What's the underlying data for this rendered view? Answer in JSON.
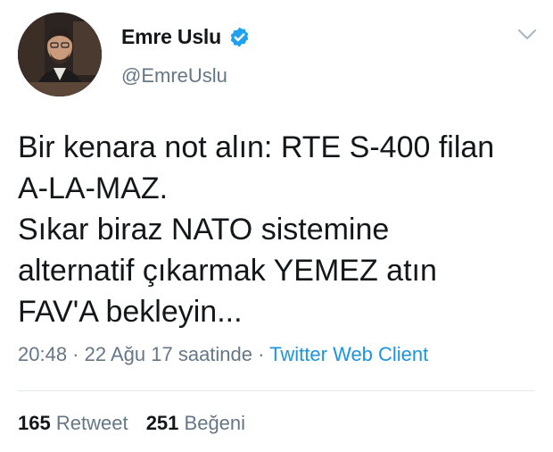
{
  "author": {
    "display_name": "Emre Uslu",
    "handle": "@EmreUslu",
    "verified": true
  },
  "icons": {
    "verified": "verified-badge-icon",
    "menu": "chevron-down-icon"
  },
  "tweet": {
    "lines": [
      "Bir kenara not alın: RTE S-400 filan",
      "A-LA-MAZ.",
      "Sıkar biraz NATO sistemine",
      "alternatif çıkarmak YEMEZ atın",
      "FAV'A bekleyin..."
    ]
  },
  "meta": {
    "time": "20:48",
    "sep1": " · ",
    "date": "22 Ağu 17 saatinde",
    "sep2": " · ",
    "client": "Twitter Web Client"
  },
  "stats": {
    "retweet_count": "165",
    "retweet_label": "Retweet",
    "like_count": "251",
    "like_label": "Beğeni"
  },
  "colors": {
    "text": "#14171a",
    "secondary": "#657786",
    "link": "#1b95e0",
    "verified": "#1da1f2",
    "divider": "#e1e8ed"
  }
}
